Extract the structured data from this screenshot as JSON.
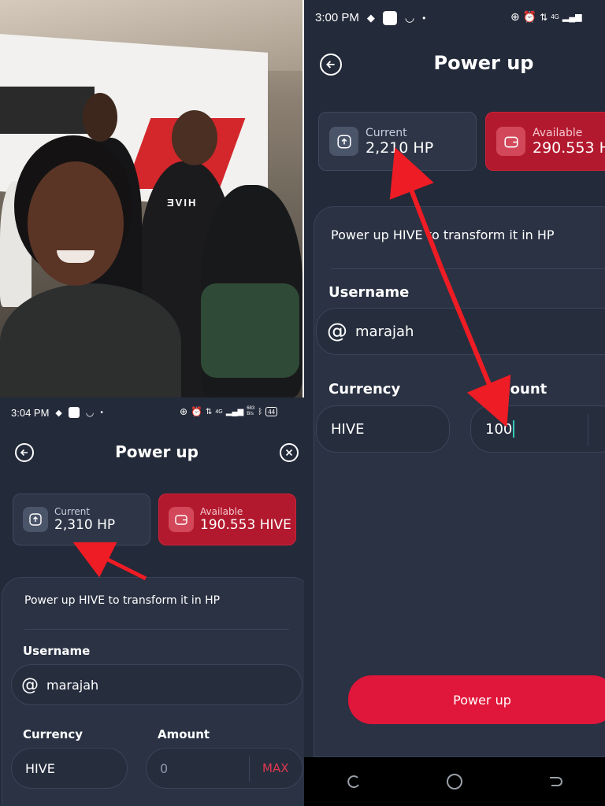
{
  "left_screen": {
    "status_bar": {
      "time": "3:04 PM",
      "net_speed": "683\nB/s",
      "network": "4G",
      "battery": "44"
    },
    "title": "Power up",
    "current_card": {
      "label": "Current",
      "value": "2,310 HP"
    },
    "available_card": {
      "label": "Available",
      "value": "190.553 HIVE"
    },
    "description": "Power up HIVE to transform it in HP",
    "username_label": "Username",
    "username_value": "marajah",
    "currency_label": "Currency",
    "currency_value": "HIVE",
    "amount_label": "Amount",
    "amount_placeholder": "0",
    "max_label": "MAX"
  },
  "right_screen": {
    "status_bar": {
      "time": "3:00 PM",
      "network": "4G"
    },
    "title": "Power up",
    "current_card": {
      "label": "Current",
      "value": "2,210 HP"
    },
    "available_card": {
      "label": "Available",
      "value": "290.553 H"
    },
    "description": "Power up HIVE to transform it in HP",
    "username_label": "Username",
    "username_value": "marajah",
    "currency_label": "Currency",
    "currency_value": "HIVE",
    "amount_label": "Amount",
    "amount_value": "100",
    "power_up_button": "Power up"
  },
  "photo": {
    "shirt_text": "ƎVIH"
  },
  "colors": {
    "background": "#232a39",
    "panel": "#2a3243",
    "accent_red": "#e0173a",
    "available_card": "#b3192e",
    "annotation_arrow": "#ee1c24"
  },
  "icons": {
    "back": "arrow-left-circle-icon",
    "close": "close-circle-icon",
    "current": "upload-box-icon",
    "available": "wallet-icon",
    "username": "at-sign-icon"
  }
}
